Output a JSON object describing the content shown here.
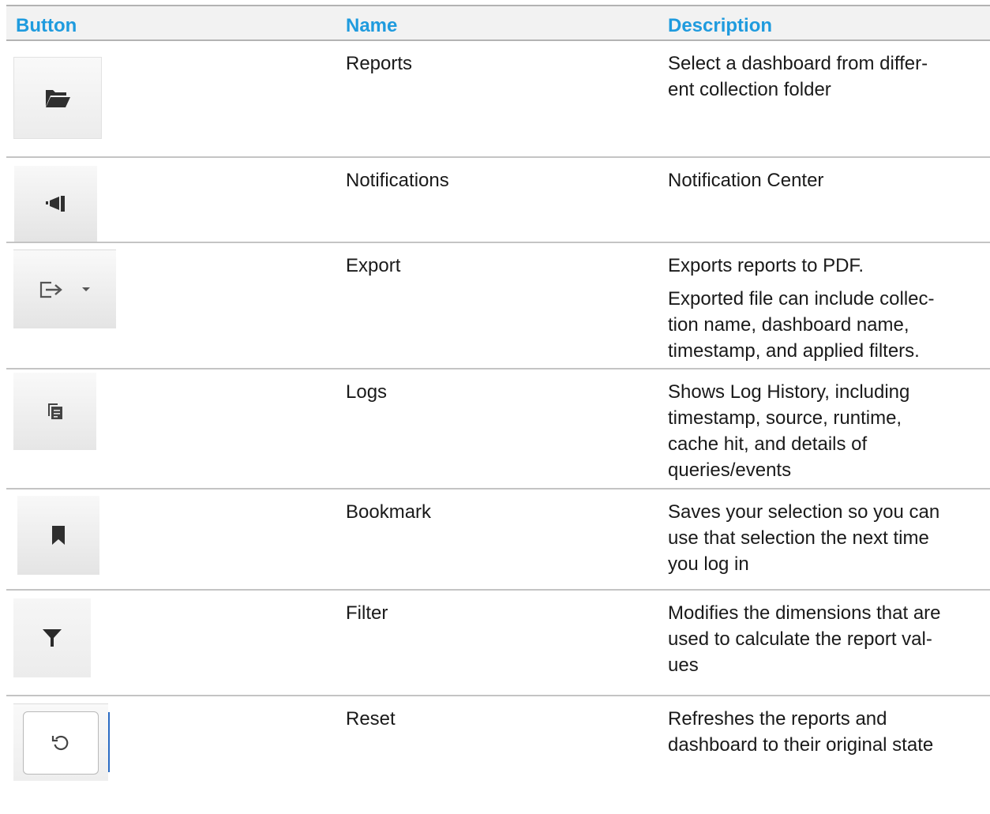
{
  "header": {
    "button": "Button",
    "name": "Name",
    "description": "Description"
  },
  "rows": [
    {
      "icon": "folder-open-icon",
      "name": "Reports",
      "description": [
        "Select a dashboard from differ-\nent collection folder"
      ]
    },
    {
      "icon": "megaphone-icon",
      "name": "Notifications",
      "description": [
        "Notification Center"
      ]
    },
    {
      "icon": "export-icon",
      "name": "Export",
      "description": [
        "Exports reports to PDF.",
        "Exported file can include collec-\ntion name, dashboard name,\ntimestamp, and applied filters."
      ]
    },
    {
      "icon": "logs-icon",
      "name": "Logs",
      "description": [
        "Shows Log History, including\ntimestamp, source, runtime,\ncache hit, and details of\nqueries/events"
      ]
    },
    {
      "icon": "bookmark-icon",
      "name": "Bookmark",
      "description": [
        "Saves your selection so you can\nuse that selection the next time\nyou log in"
      ]
    },
    {
      "icon": "filter-icon",
      "name": "Filter",
      "description": [
        "Modifies the dimensions that are\nused to calculate the report val-\nues"
      ]
    },
    {
      "icon": "reset-icon",
      "name": "Reset",
      "description": [
        "Refreshes the reports and\ndashboard to their original state"
      ]
    }
  ],
  "colors": {
    "header_text": "#1f9bde",
    "header_bg": "#f2f2f2",
    "rule": "#b3b3b3",
    "icon": "#333333"
  }
}
